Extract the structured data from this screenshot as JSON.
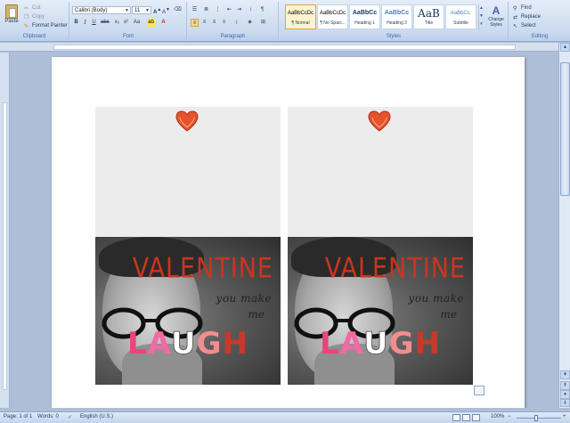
{
  "ribbon": {
    "clipboard": {
      "label": "Clipboard",
      "paste": "Paste",
      "cut": "Cut",
      "copy": "Copy",
      "format_painter": "Format Painter"
    },
    "font": {
      "label": "Font",
      "family": "Calibri (Body)",
      "size": "11"
    },
    "paragraph": {
      "label": "Paragraph"
    },
    "styles": {
      "label": "Styles",
      "tiles": [
        {
          "sample": "AaBbCcDc",
          "name": "¶ Normal"
        },
        {
          "sample": "AaBbCcDc",
          "name": "¶ No Spaci..."
        },
        {
          "sample": "AaBbCc",
          "name": "Heading 1"
        },
        {
          "sample": "AaBbCc",
          "name": "Heading 2"
        },
        {
          "sample": "AaB",
          "name": "Title"
        },
        {
          "sample": "AaBbCc.",
          "name": "Subtitle"
        }
      ],
      "change_styles": "Change Styles"
    },
    "editing": {
      "label": "Editing",
      "find": "Find",
      "replace": "Replace",
      "select": "Select"
    }
  },
  "document": {
    "cards": [
      {
        "title": "VALENTINE",
        "line1": "you make",
        "line2": "me",
        "laugh": [
          "L",
          "A",
          "U",
          "G",
          "H"
        ]
      },
      {
        "title": "VALENTINE",
        "line1": "you make",
        "line2": "me",
        "laugh": [
          "L",
          "A",
          "U",
          "G",
          "H"
        ]
      }
    ]
  },
  "statusbar": {
    "page": "Page: 1 of 1",
    "words": "Words: 0",
    "language": "English (U.S.)",
    "zoom": "100%"
  },
  "colors": {
    "accent": "#c8361e",
    "ribbon_bg": "#d0def1",
    "workspace_bg": "#aebed6"
  }
}
